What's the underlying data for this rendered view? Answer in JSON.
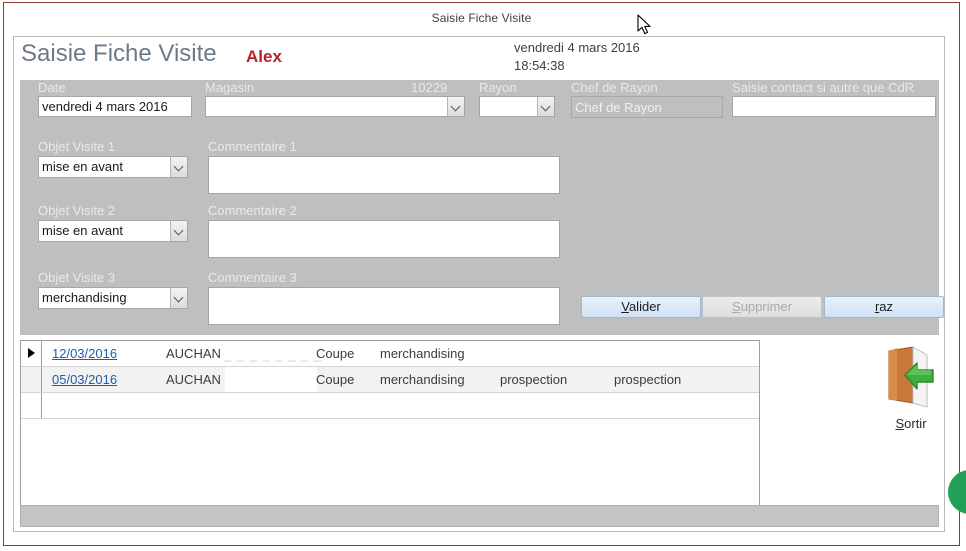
{
  "window": {
    "title": "Saisie Fiche Visite"
  },
  "header": {
    "form_title": "Saisie Fiche Visite",
    "user": "Alex",
    "date": "vendredi 4 mars 2016",
    "time": "18:54:38"
  },
  "form": {
    "date": {
      "label": "Date",
      "value": "vendredi 4 mars 2016"
    },
    "magasin": {
      "label": "Magasin",
      "code": "10229",
      "value": "",
      "placeholder": ""
    },
    "rayon": {
      "label": "Rayon",
      "value": ""
    },
    "chef_de_rayon": {
      "label": "Chef de Rayon",
      "value": "Chef de Rayon"
    },
    "contact": {
      "label": "Saisie contact si autre que CdR",
      "value": ""
    },
    "visites": [
      {
        "objet_label": "Objet Visite 1",
        "objet_value": "mise en avant",
        "commentaire_label": "Commentaire 1",
        "commentaire_value": ""
      },
      {
        "objet_label": "Objet Visite 2",
        "objet_value": "mise en avant",
        "commentaire_label": "Commentaire 2",
        "commentaire_value": ""
      },
      {
        "objet_label": "Objet Visite 3",
        "objet_value": "merchandising",
        "commentaire_label": "Commentaire 3",
        "commentaire_value": ""
      }
    ]
  },
  "buttons": {
    "valider": "Valider",
    "valider_accel": "V",
    "valider_rest": "alider",
    "supprimer": "Supprimer",
    "supprimer_accel": "S",
    "supprimer_rest": "upprimer",
    "raz": "raz",
    "raz_accel": "r",
    "raz_rest": "az",
    "sortir_accel": "S",
    "sortir_rest": "ortir",
    "sortir": "Sortir"
  },
  "grid": {
    "rows": [
      {
        "date": "12/03/2016",
        "magasin": "AUCHAN",
        "magasin_ghost": "_ _ _ _ _   _ _ _",
        "rayon": "Coupe",
        "objet1": "merchandising",
        "objet2": "",
        "objet3": "",
        "selected": true
      },
      {
        "date": "05/03/2016",
        "magasin": "AUCHAN",
        "magasin_ghost": "",
        "rayon": "Coupe",
        "objet1": "merchandising",
        "objet2": "prospection",
        "objet3": "prospection",
        "selected": false
      },
      {
        "date": "",
        "magasin": "",
        "magasin_ghost": "",
        "rayon": "",
        "objet1": "",
        "objet2": "",
        "objet3": "",
        "selected": false
      }
    ]
  },
  "colors": {
    "window_border": "#8c3a3a",
    "entry_background": "#bfbfbf",
    "title_text": "#6c7a89",
    "user_text": "#b4232a",
    "link_text": "#1f5fa9",
    "button_face": "#cfe2f5",
    "accent_green": "#22a05a"
  }
}
